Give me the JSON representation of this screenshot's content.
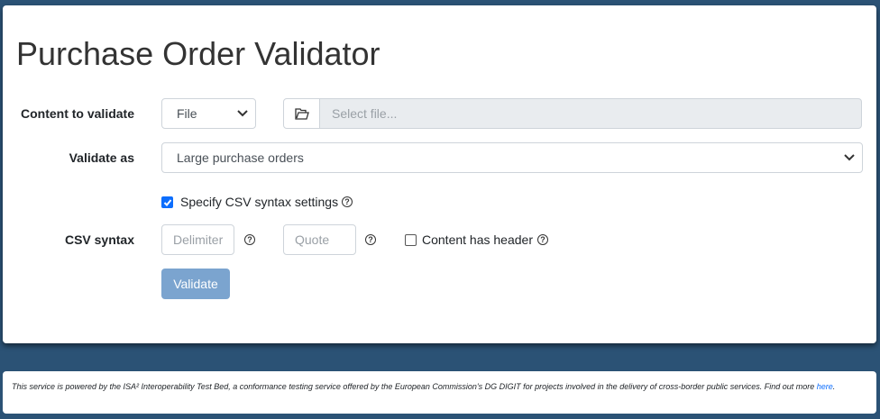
{
  "page": {
    "title": "Purchase Order Validator"
  },
  "form": {
    "content_label": "Content to validate",
    "content_type_value": "File",
    "file_placeholder": "Select file...",
    "validate_as_label": "Validate as",
    "validate_as_value": "Large purchase orders",
    "csv_settings_checkbox_label": "Specify CSV syntax settings",
    "csv_settings_checked": true,
    "csv_syntax_label": "CSV syntax",
    "delimiter_placeholder": "Delimiter",
    "quote_placeholder": "Quote",
    "header_checkbox_label": "Content has header",
    "header_checked": false,
    "validate_button": "Validate"
  },
  "footer": {
    "text": "This service is powered by the ISA² Interoperability Test Bed, a conformance testing service offered by the European Commission's DG DIGIT for projects involved in the delivery of cross-border public services. Find out more ",
    "link_text": "here",
    "end": "."
  },
  "colors": {
    "background": "#2b5275",
    "button_disabled": "#7ba4cf",
    "checkbox_checked": "#0d6efd"
  },
  "icons": [
    "folder-open-icon",
    "chevron-down-icon",
    "question-circle-icon",
    "check-icon"
  ]
}
